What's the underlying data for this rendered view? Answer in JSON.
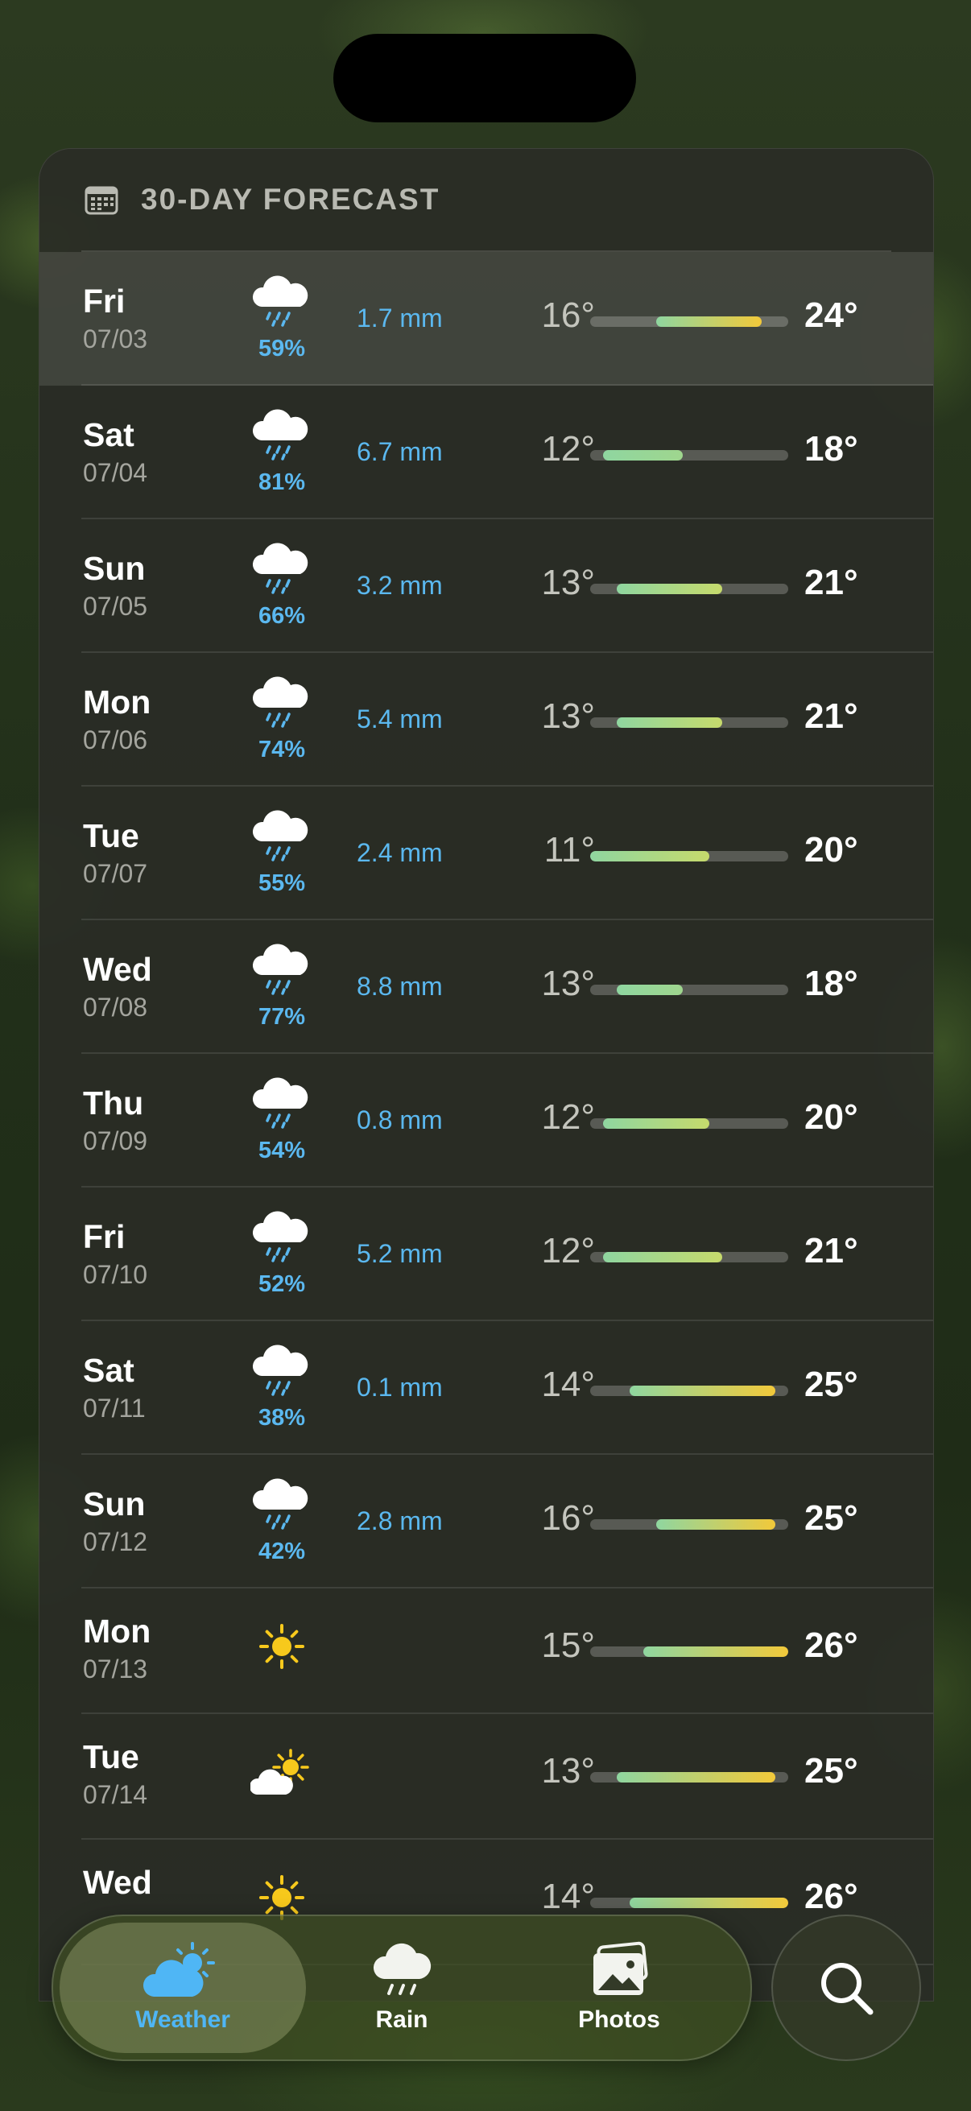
{
  "header": {
    "title": "30-DAY FORECAST",
    "icon": "calendar-icon"
  },
  "colors": {
    "accent_blue": "#5bb8ef",
    "bar_green": "#8fd6a0",
    "bar_yellow": "#f2c93a",
    "sun": "#f7c91c"
  },
  "temp_range": [
    11,
    26
  ],
  "days": [
    {
      "day": "Fri",
      "date": "07/03",
      "icon": "rain-cloud-icon",
      "pop": "59%",
      "precip": "1.7 mm",
      "low": "16°",
      "high": "24°",
      "low_val": 16,
      "high_val": 24,
      "selected": true
    },
    {
      "day": "Sat",
      "date": "07/04",
      "icon": "rain-cloud-icon",
      "pop": "81%",
      "precip": "6.7 mm",
      "low": "12°",
      "high": "18°",
      "low_val": 12,
      "high_val": 18
    },
    {
      "day": "Sun",
      "date": "07/05",
      "icon": "rain-cloud-icon",
      "pop": "66%",
      "precip": "3.2 mm",
      "low": "13°",
      "high": "21°",
      "low_val": 13,
      "high_val": 21
    },
    {
      "day": "Mon",
      "date": "07/06",
      "icon": "rain-cloud-icon",
      "pop": "74%",
      "precip": "5.4 mm",
      "low": "13°",
      "high": "21°",
      "low_val": 13,
      "high_val": 21
    },
    {
      "day": "Tue",
      "date": "07/07",
      "icon": "rain-cloud-icon",
      "pop": "55%",
      "precip": "2.4 mm",
      "low": "11°",
      "high": "20°",
      "low_val": 11,
      "high_val": 20
    },
    {
      "day": "Wed",
      "date": "07/08",
      "icon": "rain-cloud-icon",
      "pop": "77%",
      "precip": "8.8 mm",
      "low": "13°",
      "high": "18°",
      "low_val": 13,
      "high_val": 18
    },
    {
      "day": "Thu",
      "date": "07/09",
      "icon": "rain-cloud-icon",
      "pop": "54%",
      "precip": "0.8 mm",
      "low": "12°",
      "high": "20°",
      "low_val": 12,
      "high_val": 20
    },
    {
      "day": "Fri",
      "date": "07/10",
      "icon": "rain-cloud-icon",
      "pop": "52%",
      "precip": "5.2 mm",
      "low": "12°",
      "high": "21°",
      "low_val": 12,
      "high_val": 21
    },
    {
      "day": "Sat",
      "date": "07/11",
      "icon": "rain-cloud-icon",
      "pop": "38%",
      "precip": "0.1 mm",
      "low": "14°",
      "high": "25°",
      "low_val": 14,
      "high_val": 25
    },
    {
      "day": "Sun",
      "date": "07/12",
      "icon": "rain-cloud-icon",
      "pop": "42%",
      "precip": "2.8 mm",
      "low": "16°",
      "high": "25°",
      "low_val": 16,
      "high_val": 25
    },
    {
      "day": "Mon",
      "date": "07/13",
      "icon": "sun-icon",
      "pop": "",
      "precip": "",
      "low": "15°",
      "high": "26°",
      "low_val": 15,
      "high_val": 26
    },
    {
      "day": "Tue",
      "date": "07/14",
      "icon": "partly-cloudy-icon",
      "pop": "",
      "precip": "",
      "low": "13°",
      "high": "25°",
      "low_val": 13,
      "high_val": 25
    },
    {
      "day": "Wed",
      "date": "",
      "icon": "sun-icon",
      "pop": "",
      "precip": "",
      "low": "14°",
      "high": "26°",
      "low_val": 14,
      "high_val": 26
    }
  ],
  "tabs": [
    {
      "label": "Weather",
      "icon": "partly-cloudy-icon",
      "active": true
    },
    {
      "label": "Rain",
      "icon": "rain-cloud-icon",
      "active": false
    },
    {
      "label": "Photos",
      "icon": "photos-icon",
      "active": false
    }
  ],
  "search": {
    "icon": "search-icon"
  }
}
